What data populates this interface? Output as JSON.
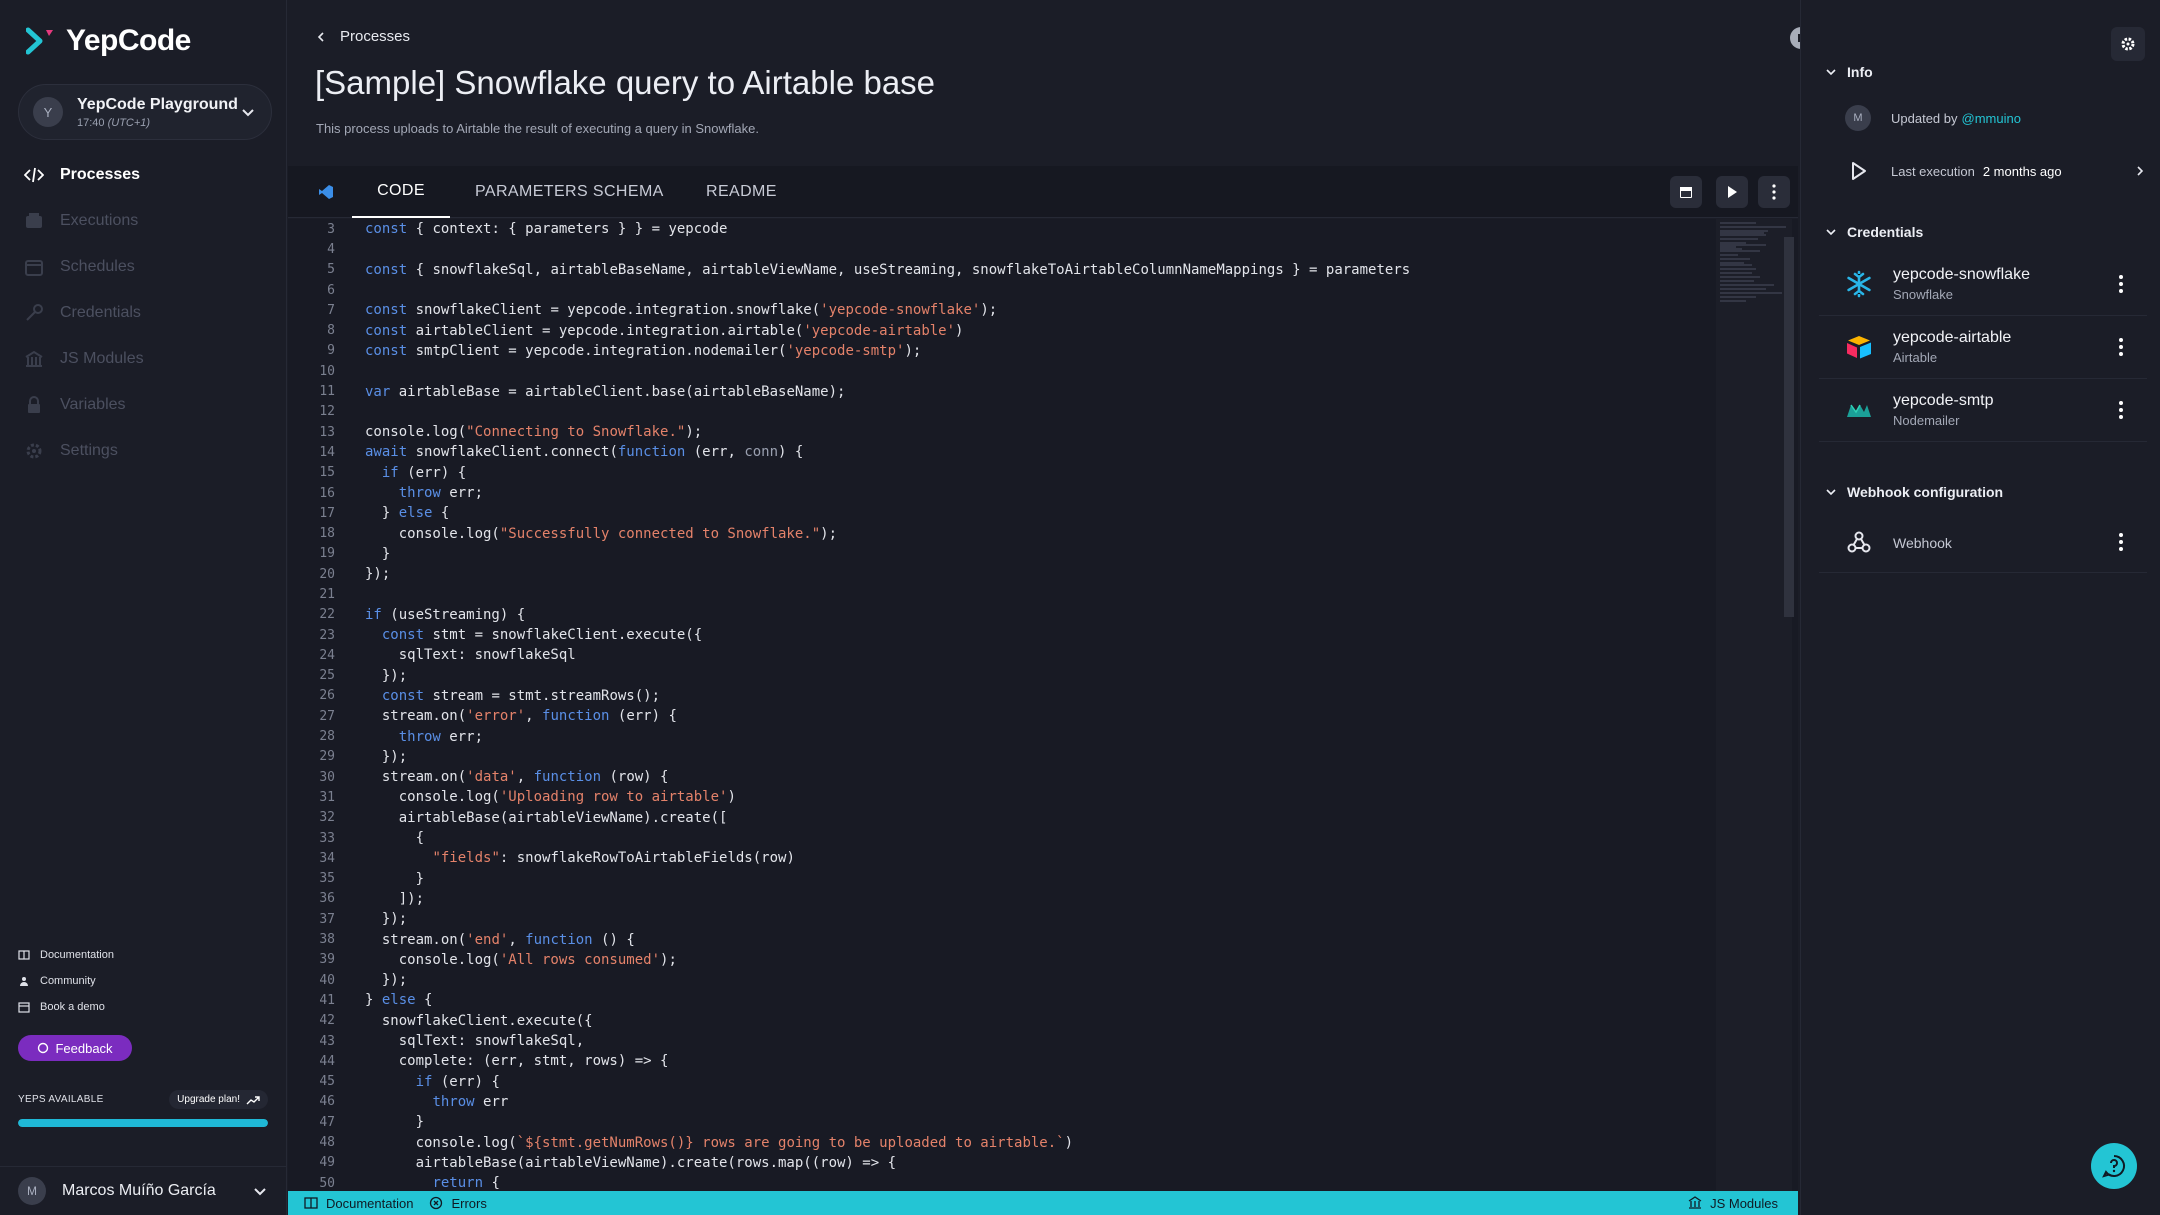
{
  "app": {
    "name": "YepCode"
  },
  "workspace": {
    "name": "YepCode Playground",
    "time": "17:40",
    "timezone": "(UTC+1)",
    "avatar_letter": "Y"
  },
  "nav": [
    {
      "label": "Processes",
      "icon": "code-icon",
      "active": true
    },
    {
      "label": "Executions",
      "icon": "executions-icon",
      "active": false
    },
    {
      "label": "Schedules",
      "icon": "calendar-icon",
      "active": false
    },
    {
      "label": "Credentials",
      "icon": "key-icon",
      "active": false
    },
    {
      "label": "JS Modules",
      "icon": "modules-icon",
      "active": false
    },
    {
      "label": "Variables",
      "icon": "lock-icon",
      "active": false
    },
    {
      "label": "Settings",
      "icon": "gear-icon",
      "active": false
    }
  ],
  "bottom_links": [
    {
      "label": "Documentation",
      "icon": "book-icon"
    },
    {
      "label": "Community",
      "icon": "community-icon"
    },
    {
      "label": "Book a demo",
      "icon": "calendar-icon"
    }
  ],
  "feedback": {
    "label": "Feedback"
  },
  "yeps": {
    "label": "YEPS AVAILABLE",
    "upgrade_label": "Upgrade plan!",
    "fill_fraction": 1.0
  },
  "user": {
    "name": "Marcos Muíño García",
    "avatar_letter": "M"
  },
  "header": {
    "breadcrumb": "Processes",
    "title": "[Sample] Snowflake query to Airtable base",
    "description": "This process uploads to Airtable the result of executing a query in Snowflake."
  },
  "tabs": [
    {
      "label": "CODE",
      "active": true
    },
    {
      "label": "PARAMETERS SCHEMA",
      "active": false
    },
    {
      "label": "README",
      "active": false
    }
  ],
  "code_lines": [
    {
      "n": "3",
      "html": "<span class=\"kw\">const</span> { context: { parameters } } = yepcode"
    },
    {
      "n": "4",
      "html": ""
    },
    {
      "n": "5",
      "html": "<span class=\"kw\">const</span> { snowflakeSql, airtableBaseName, airtableViewName, useStreaming, snowflakeToAirtableColumnNameMappings } = parameters"
    },
    {
      "n": "6",
      "html": ""
    },
    {
      "n": "7",
      "html": "<span class=\"kw\">const</span> snowflakeClient = yepcode.integration.snowflake(<span class=\"str\">'yepcode-snowflake'</span>);"
    },
    {
      "n": "8",
      "html": "<span class=\"kw\">const</span> airtableClient = yepcode.integration.airtable(<span class=\"str\">'yepcode-airtable'</span>)"
    },
    {
      "n": "9",
      "html": "<span class=\"kw\">const</span> smtpClient = yepcode.integration.nodemailer(<span class=\"str\">'yepcode-smtp'</span>);"
    },
    {
      "n": "10",
      "html": ""
    },
    {
      "n": "11",
      "html": "<span class=\"kw\">var</span> airtableBase = airtableClient.base(airtableBaseName);"
    },
    {
      "n": "12",
      "html": ""
    },
    {
      "n": "13",
      "html": "console.log(<span class=\"str\">\"Connecting to Snowflake.\"</span>);"
    },
    {
      "n": "14",
      "html": "<span class=\"kw\">await</span> snowflakeClient.connect(<span class=\"kw\">function</span> (err, <span class=\"prm\">conn</span>) {"
    },
    {
      "n": "15",
      "html": "  <span class=\"kw\">if</span> (err) {"
    },
    {
      "n": "16",
      "html": "    <span class=\"kw\">throw</span> err;"
    },
    {
      "n": "17",
      "html": "  } <span class=\"kw\">else</span> {"
    },
    {
      "n": "18",
      "html": "    console.log(<span class=\"str\">\"Successfully connected to Snowflake.\"</span>);"
    },
    {
      "n": "19",
      "html": "  }"
    },
    {
      "n": "20",
      "html": "});"
    },
    {
      "n": "21",
      "html": ""
    },
    {
      "n": "22",
      "html": "<span class=\"kw\">if</span> (useStreaming) {"
    },
    {
      "n": "23",
      "html": "  <span class=\"kw\">const</span> stmt = snowflakeClient.execute({"
    },
    {
      "n": "24",
      "html": "    sqlText: snowflakeSql"
    },
    {
      "n": "25",
      "html": "  });"
    },
    {
      "n": "26",
      "html": "  <span class=\"kw\">const</span> stream = stmt.streamRows();"
    },
    {
      "n": "27",
      "html": "  stream.on(<span class=\"str\">'error'</span>, <span class=\"kw\">function</span> (err) {"
    },
    {
      "n": "28",
      "html": "    <span class=\"kw\">throw</span> err;"
    },
    {
      "n": "29",
      "html": "  });"
    },
    {
      "n": "30",
      "html": "  stream.on(<span class=\"str\">'data'</span>, <span class=\"kw\">function</span> (row) {"
    },
    {
      "n": "31",
      "html": "    console.log(<span class=\"str\">'Uploading row to airtable'</span>)"
    },
    {
      "n": "32",
      "html": "    airtableBase(airtableViewName).create(["
    },
    {
      "n": "33",
      "html": "      {"
    },
    {
      "n": "34",
      "html": "        <span class=\"str\">\"fields\"</span>: snowflakeRowToAirtableFields(row)"
    },
    {
      "n": "35",
      "html": "      }"
    },
    {
      "n": "36",
      "html": "    ]);"
    },
    {
      "n": "37",
      "html": "  });"
    },
    {
      "n": "38",
      "html": "  stream.on(<span class=\"str\">'end'</span>, <span class=\"kw\">function</span> () {"
    },
    {
      "n": "39",
      "html": "    console.log(<span class=\"str\">'All rows consumed'</span>);"
    },
    {
      "n": "40",
      "html": "  });"
    },
    {
      "n": "41",
      "html": "} <span class=\"kw\">else</span> {"
    },
    {
      "n": "42",
      "html": "  snowflakeClient.execute({"
    },
    {
      "n": "43",
      "html": "    sqlText: snowflakeSql,"
    },
    {
      "n": "44",
      "html": "    complete: (err, stmt, rows) => {"
    },
    {
      "n": "45",
      "html": "      <span class=\"kw\">if</span> (err) {"
    },
    {
      "n": "46",
      "html": "        <span class=\"kw\">throw</span> err"
    },
    {
      "n": "47",
      "html": "      }"
    },
    {
      "n": "48",
      "html": "      console.log(<span class=\"str\">`${stmt.getNumRows()} rows are going to be uploaded to airtable.`</span>)"
    },
    {
      "n": "49",
      "html": "      airtableBase(airtableViewName).create(rows.map((row) => {"
    },
    {
      "n": "50",
      "html": "        <span class=\"kw\">return</span> {"
    }
  ],
  "status_bar": {
    "documentation": "Documentation",
    "errors": "Errors",
    "js_modules": "JS Modules"
  },
  "info": {
    "heading": "Info",
    "updated_prefix": "Updated by",
    "updated_user": "@mmuino",
    "updated_avatar_letter": "M",
    "last_exec_label": "Last execution",
    "last_exec_value": "2 months ago"
  },
  "credentials": {
    "heading": "Credentials",
    "items": [
      {
        "name": "yepcode-snowflake",
        "type": "Snowflake",
        "icon": "snowflake-icon"
      },
      {
        "name": "yepcode-airtable",
        "type": "Airtable",
        "icon": "airtable-icon"
      },
      {
        "name": "yepcode-smtp",
        "type": "Nodemailer",
        "icon": "nodemailer-icon"
      }
    ]
  },
  "webhook": {
    "heading": "Webhook configuration",
    "label": "Webhook"
  },
  "colors": {
    "accent": "#23c5d4",
    "feedback": "#7b2cbf",
    "keyword": "#5a8fe6",
    "string": "#e4826a"
  }
}
